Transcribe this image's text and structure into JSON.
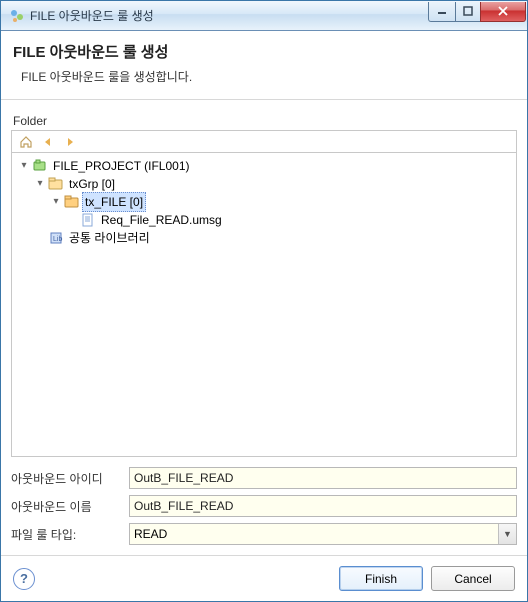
{
  "window": {
    "title": "FILE 아웃바운드 룰 생성"
  },
  "header": {
    "title": "FILE 아웃바운드 룰 생성",
    "desc": "FILE 아웃바운드 룰을 생성합니다."
  },
  "folder": {
    "label": "Folder"
  },
  "tree": {
    "root": {
      "label": "FILE_PROJECT  (IFL001)"
    },
    "txGrp": {
      "label": "txGrp [0]"
    },
    "txFile": {
      "label": "tx_FILE [0]"
    },
    "reqFile": {
      "label": "Req_File_READ.umsg"
    },
    "commonLib": {
      "label": "공통 라이브러리"
    }
  },
  "form": {
    "id_label": "아웃바운드 아이디",
    "id_value": "OutB_FILE_READ",
    "name_label": "아웃바운드 이름",
    "name_value": "OutB_FILE_READ",
    "type_label": "파일 룰 타입:",
    "type_value": "READ"
  },
  "buttons": {
    "finish": "Finish",
    "cancel": "Cancel"
  }
}
